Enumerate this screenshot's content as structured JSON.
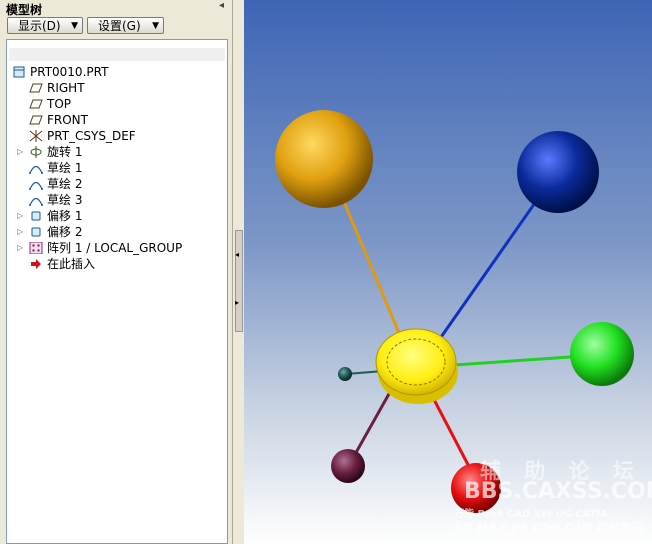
{
  "panel": {
    "title": "模型树"
  },
  "toolbar": {
    "show_label": "显示(D)",
    "settings_label": "设置(G)"
  },
  "tree": {
    "root": "PRT0010.PRT",
    "items": [
      {
        "label": "RIGHT"
      },
      {
        "label": "TOP"
      },
      {
        "label": "FRONT"
      },
      {
        "label": "PRT_CSYS_DEF"
      },
      {
        "label": "旋转 1"
      },
      {
        "label": "草绘 1"
      },
      {
        "label": "草绘 2"
      },
      {
        "label": "草绘 3"
      },
      {
        "label": "偏移 1"
      },
      {
        "label": "偏移 2"
      },
      {
        "label": "阵列 1 / LOCAL_GROUP"
      },
      {
        "label": "在此插入"
      }
    ]
  },
  "watermark": {
    "line1": "辅 助 论 坛",
    "line2": "BBS.CAXSS.COM",
    "line3": "万能 ProE CAD SW UG CATIA",
    "line4": "3D MAX PS CDR C4D 视频教程"
  },
  "colors": {
    "sphere_orange": "#e0a010",
    "sphere_blue": "#0a2a9a",
    "sphere_green": "#22e022",
    "sphere_red": "#e81010",
    "sphere_purple": "#6a2040",
    "sphere_teal": "#1e5a55",
    "center_yellow": "#ffee10"
  }
}
